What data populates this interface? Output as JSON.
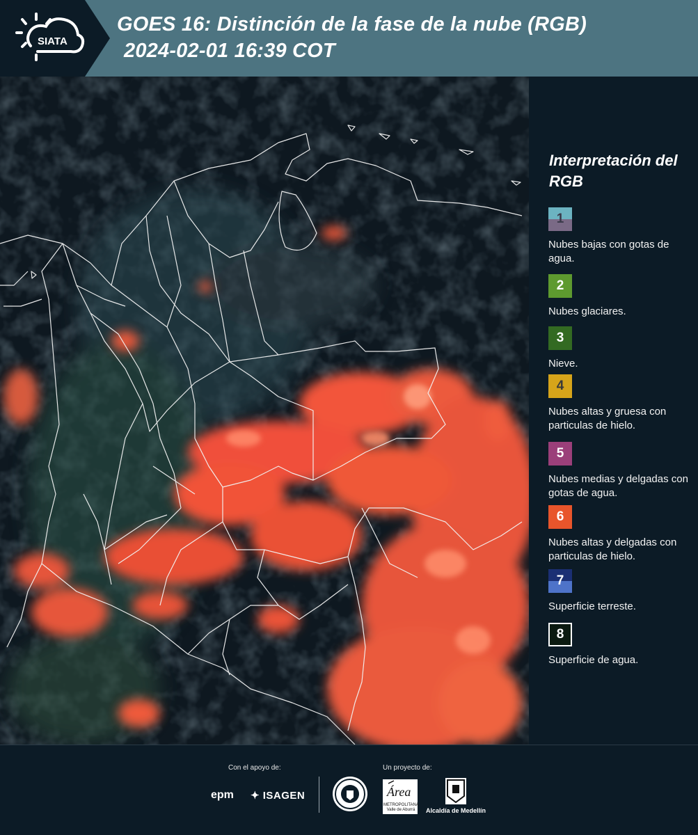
{
  "header": {
    "logo_text": "SIATA",
    "title_line1": "GOES 16: Distinción de la fase de la nube (RGB)",
    "title_line2": "2024-02-01 16:39 COT"
  },
  "legend": {
    "title": "Interpretación del RGB",
    "items": [
      {
        "number": "1",
        "label": "Nubes bajas con gotas de agua.",
        "color_top": "#6cb3c1",
        "color_bottom": "#7a6a86"
      },
      {
        "number": "2",
        "label": "Nubes glaciares.",
        "color": "#5e9a2f"
      },
      {
        "number": "3",
        "label": "Nieve.",
        "color": "#336a22"
      },
      {
        "number": "4",
        "label": "Nubes altas y gruesa con particulas de hielo.",
        "color": "#d6a41a"
      },
      {
        "number": "5",
        "label": "Nubes medias y delgadas con gotas de agua.",
        "color": "#9b3f7a"
      },
      {
        "number": "6",
        "label": "Nubes altas y delgadas con particulas de hielo.",
        "color": "#e8552b"
      },
      {
        "number": "7",
        "label": "Superficie terreste.",
        "color_top": "#1b2f74",
        "color_bottom": "#4e73c9"
      },
      {
        "number": "8",
        "label": "Superficie de agua.",
        "color": "#0b1a10"
      }
    ]
  },
  "footer": {
    "support_label": "Con el apoyo de:",
    "project_label": "Un proyecto de:",
    "sponsor_1": "epm",
    "sponsor_2": "ISAGEN",
    "partner_amva": "METROPOLITANA Valle de Aburrá",
    "partner_alcaldia": "Alcaldía de Medellín"
  }
}
